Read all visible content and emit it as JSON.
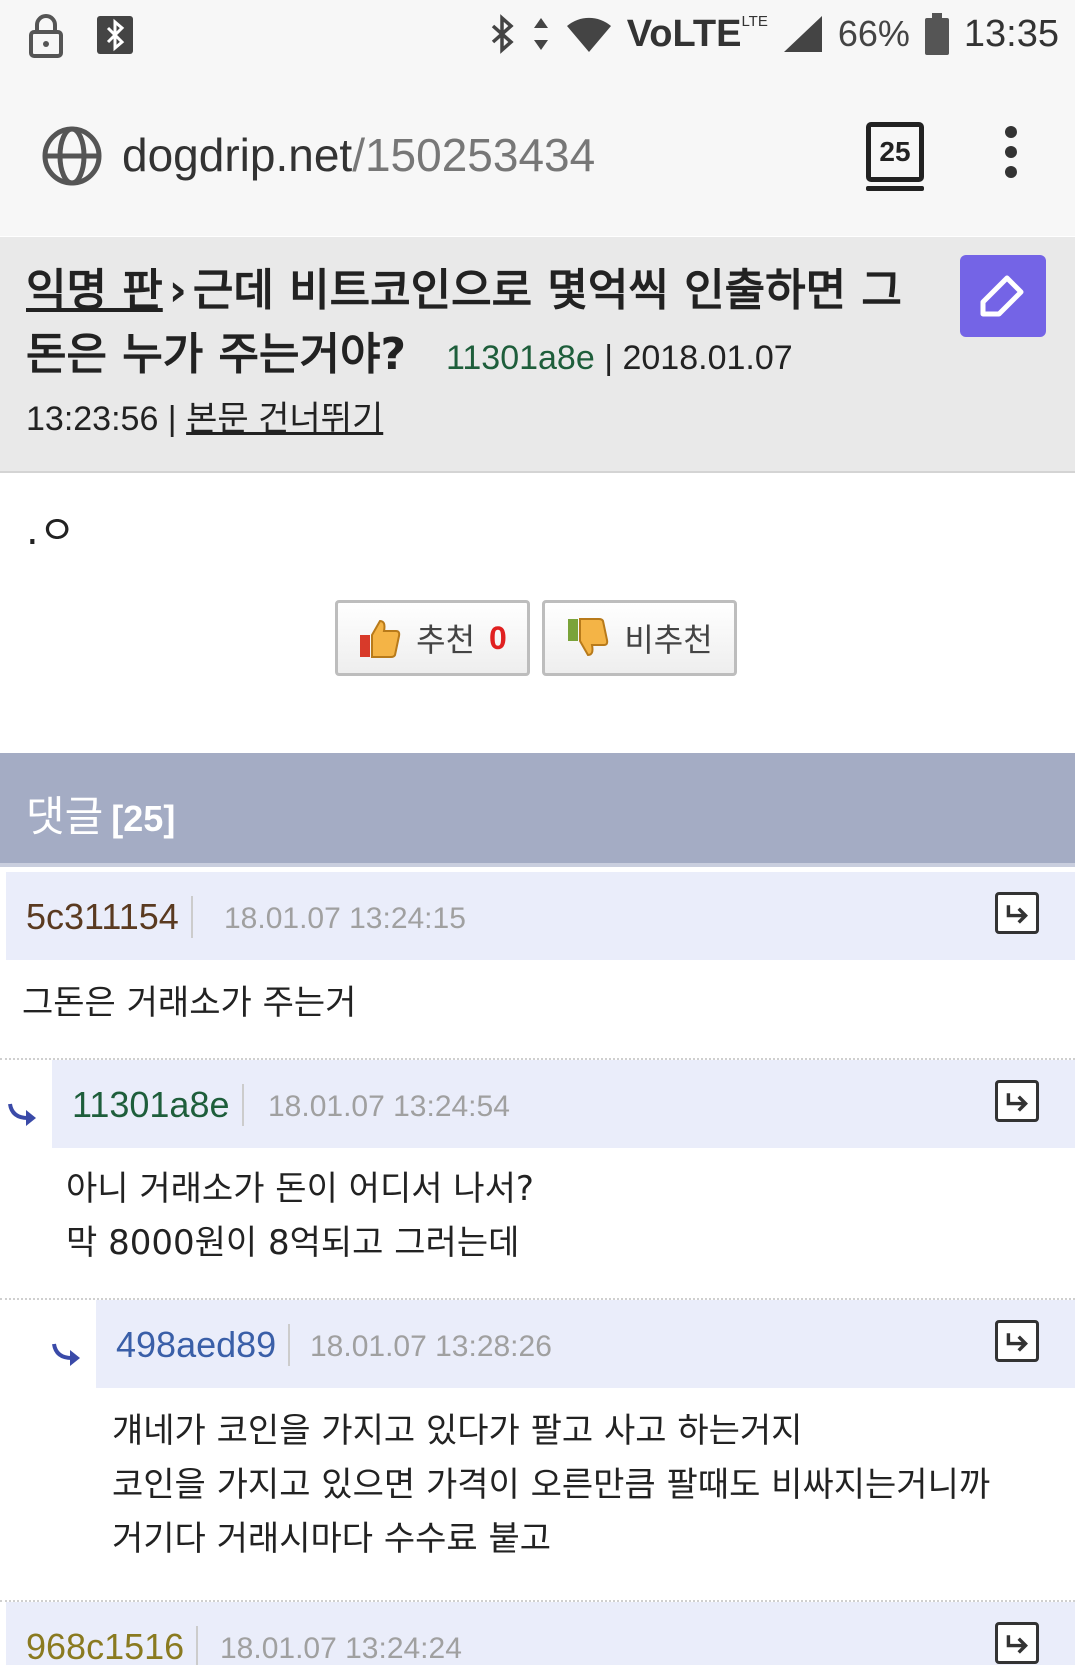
{
  "status_bar": {
    "battery": "66%",
    "time": "13:35",
    "network": "VoLTE",
    "network_sub": "LTE",
    "icons": [
      "lock-icon",
      "bluetooth-app-icon",
      "bluetooth-icon",
      "data-arrows-icon",
      "wifi-icon",
      "signal-icon",
      "battery-icon"
    ]
  },
  "browser": {
    "url_domain": "dogdrip.net",
    "url_path": "/150253434",
    "tab_count": "25"
  },
  "post": {
    "board": "익명 판",
    "separator": "›",
    "title": "근데 비트코인으로 몇억씩 인출하면 그 돈은 누가 주는거야?",
    "author": "11301a8e",
    "date": "2018.01.07",
    "time": "13:23:56",
    "skip_link": "본문 건너뛰기",
    "body": ".ㅇ",
    "upvote_label": "추천",
    "upvote_count": "0",
    "downvote_label": "비추천"
  },
  "comments_section": {
    "label": "댓글",
    "count": "[25]"
  },
  "comments": [
    {
      "author": "5c311154",
      "date": "18.01.07 13:24:15",
      "lines": [
        "그돈은 거래소가 주는거"
      ],
      "author_color": "#5a3a20"
    },
    {
      "author": "11301a8e",
      "date": "18.01.07 13:24:54",
      "lines": [
        "아니 거래소가 돈이 어디서 나서?",
        "막 8000원이 8억되고 그러는데"
      ],
      "author_color": "#1e5e3b"
    },
    {
      "author": "498aed89",
      "date": "18.01.07 13:28:26",
      "lines": [
        "걔네가 코인을 가지고 있다가 팔고 사고 하는거지",
        "코인을 가지고 있으면 가격이 오른만큼 팔때도 비싸지는거니까",
        "거기다 거래시마다 수수료 붙고"
      ],
      "author_color": "#3a5fa8"
    },
    {
      "author": "968c1516",
      "date": "18.01.07 13:24:24",
      "lines": [],
      "author_color": "#8a7a20"
    }
  ]
}
